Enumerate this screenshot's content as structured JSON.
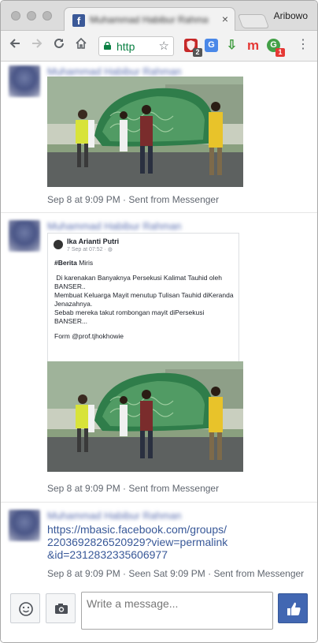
{
  "browser": {
    "tab_title": "Muhammad Habibur Rahman",
    "tab_favicon": "f",
    "tab_close": "×",
    "profile_name": "Aribowo",
    "url": "http",
    "icons": [
      "back-icon",
      "forward-icon",
      "reload-icon",
      "home-icon",
      "lock-icon",
      "star-icon",
      "menu-icon"
    ],
    "extensions": [
      {
        "name": "ublock-extension-icon",
        "glyph": "",
        "badge": "2"
      },
      {
        "name": "translate-extension-icon",
        "glyph": "G",
        "badge": ""
      },
      {
        "name": "download-extension-icon",
        "glyph": "⇩",
        "badge": ""
      },
      {
        "name": "mendeley-extension-icon",
        "glyph": "m",
        "badge": ""
      },
      {
        "name": "grammarly-extension-icon",
        "glyph": "G",
        "badge": "1"
      }
    ]
  },
  "messages": [
    {
      "sender": "Muhammad Habibur Rahman",
      "meta": "Sep 8 at 9:09 PM · Sent from Messenger"
    },
    {
      "sender": "Muhammad Habibur Rahman",
      "post": {
        "author": "Ika Arianti Putri",
        "date": "7 Sep at 07:52 · ",
        "hashtag": "#Berita",
        "headline_rest": " Miris",
        "para1": "Di karenakan Banyaknya Persekusi Kalimat Tauhid oleh BANSER..",
        "para2": "Membuat Keluarga Mayit menutup Tulisan Tauhid diKeranda Jenazahnya.",
        "para3": "Sebab mereka takut rombongan mayit diPersekusi BANSER...",
        "para4": "Form @prof.tjhokhowie"
      },
      "meta": "Sep 8 at 9:09 PM · Sent from Messenger"
    },
    {
      "sender": "Muhammad Habibur Rahman",
      "link": "https://mbasic.facebook.com/groups/220369282652092​9?view=permalink&id=2312832335606977",
      "link_lines": [
        "https://mbasic.facebook.com/groups/",
        "2203692826520929?view=permalink",
        "&id=2312832335606977"
      ],
      "meta": "Sep 8 at 9:09 PM · Seen Sat 9:09 PM · Sent from Messenger"
    }
  ],
  "composer": {
    "placeholder": "Write a message...",
    "icons": [
      "emoji-icon",
      "camera-icon",
      "thumbs-up-icon"
    ]
  },
  "colors": {
    "facebook_blue": "#4267b2",
    "link": "#385898",
    "meta_text": "#616770",
    "url_green": "#0b8043"
  }
}
